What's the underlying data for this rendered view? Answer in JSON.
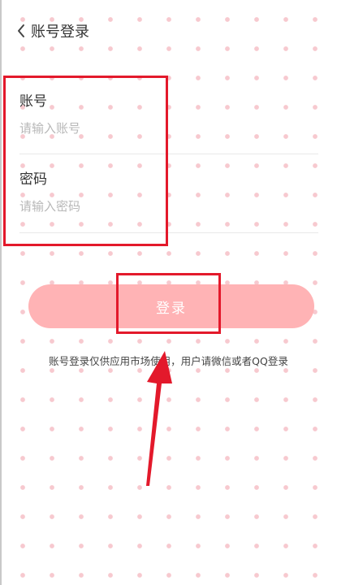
{
  "header": {
    "title": "账号登录",
    "back_icon": "chevron-left-icon"
  },
  "form": {
    "account": {
      "label": "账号",
      "placeholder": "请输入账号",
      "value": ""
    },
    "password": {
      "label": "密码",
      "placeholder": "请输入密码",
      "value": ""
    }
  },
  "login_button": {
    "label": "登录"
  },
  "notice": "账号登录仅供应用市场使用，用户请微信或者QQ登录",
  "colors": {
    "background": "#ffffff",
    "dot": "#f7c9cf",
    "button": "#ffb3b5",
    "annotation": "#e3192b",
    "title_text": "#333333",
    "placeholder": "#b8b8b8"
  }
}
